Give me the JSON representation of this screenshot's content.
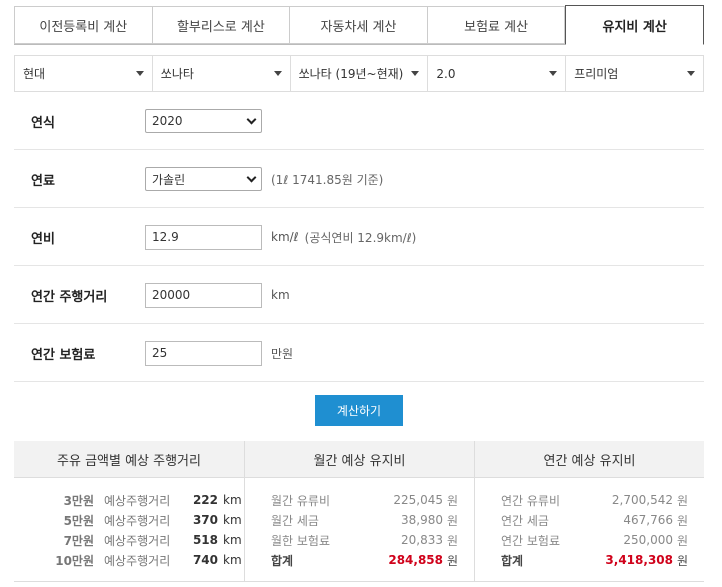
{
  "tabs": [
    "이전등록비 계산",
    "할부리스로 계산",
    "자동차세 계산",
    "보험료 계산",
    "유지비 계산"
  ],
  "active_tab": 4,
  "vehicle_selects": {
    "maker": "현대",
    "model": "쏘나타",
    "generation": "쏘나타 (19년~현재)",
    "engine": "2.0",
    "trim": "프리미엄"
  },
  "form": {
    "year": {
      "label": "연식",
      "value": "2020"
    },
    "fuel": {
      "label": "연료",
      "value": "가솔린",
      "note": "(1ℓ 1741.85원 기준)"
    },
    "efficiency": {
      "label": "연비",
      "value": "12.9",
      "unit": "km/ℓ",
      "note": "(공식연비 12.9km/ℓ)"
    },
    "distance": {
      "label": "연간 주행거리",
      "value": "20000",
      "unit": "km"
    },
    "insurance": {
      "label": "연간 보험료",
      "value": "25",
      "unit": "만원"
    }
  },
  "calc_button": "계산하기",
  "results": {
    "col1": {
      "header": "주유 금액별 예상 주행거리",
      "rows": [
        {
          "amount": "3만원",
          "label": "예상주행거리",
          "value": "222",
          "unit": "km"
        },
        {
          "amount": "5만원",
          "label": "예상주행거리",
          "value": "370",
          "unit": "km"
        },
        {
          "amount": "7만원",
          "label": "예상주행거리",
          "value": "518",
          "unit": "km"
        },
        {
          "amount": "10만원",
          "label": "예상주행거리",
          "value": "740",
          "unit": "km"
        }
      ]
    },
    "col2": {
      "header": "월간 예상 유지비",
      "rows": [
        {
          "label": "월간 유류비",
          "value": "225,045",
          "unit": "원"
        },
        {
          "label": "월간 세금",
          "value": "38,980",
          "unit": "원"
        },
        {
          "label": "월한 보험료",
          "value": "20,833",
          "unit": "원"
        },
        {
          "label": "합계",
          "value": "284,858",
          "unit": "원"
        }
      ]
    },
    "col3": {
      "header": "연간 예상 유지비",
      "rows": [
        {
          "label": "연간 유류비",
          "value": "2,700,542",
          "unit": "원"
        },
        {
          "label": "연간 세금",
          "value": "467,766",
          "unit": "원"
        },
        {
          "label": "연간 보험료",
          "value": "250,000",
          "unit": "원"
        },
        {
          "label": "합계",
          "value": "3,418,308",
          "unit": "원"
        }
      ]
    }
  },
  "colors": {
    "accent": "#1f8fd1",
    "total": "#d0021b"
  }
}
